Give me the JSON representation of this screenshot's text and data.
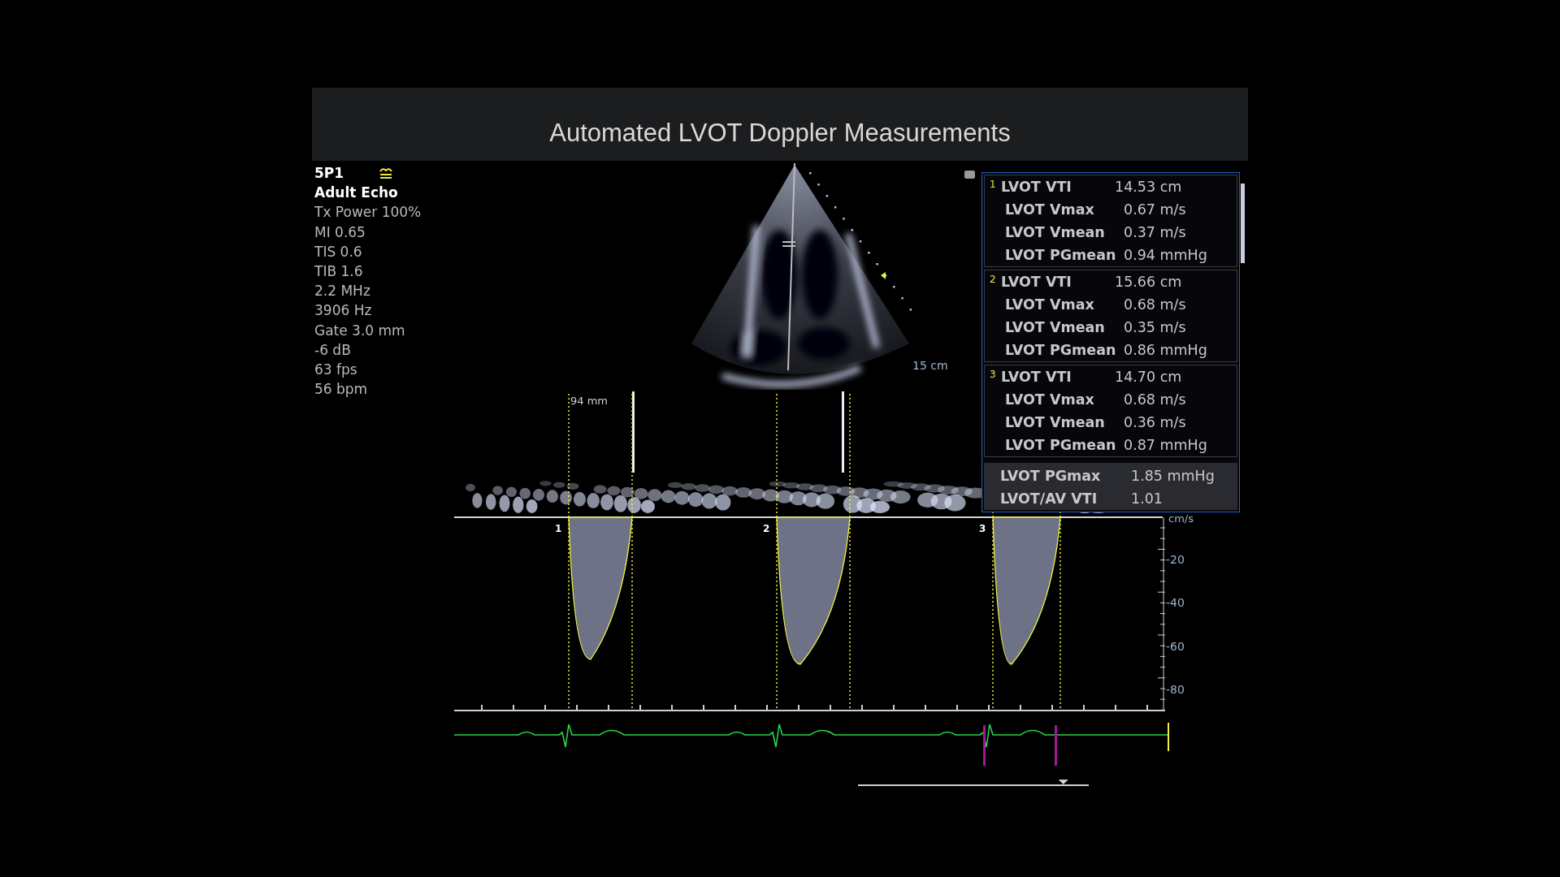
{
  "title": "Automated LVOT Doppler Measurements",
  "probe": {
    "name": "5P1",
    "preset": "Adult Echo",
    "parameters": [
      "Tx Power 100%",
      "MI 0.65",
      "TIS 0.6",
      "TIB 1.6",
      "2.2 MHz",
      "3906 Hz",
      "Gate 3.0 mm",
      "-6 dB",
      "63 fps",
      "56 bpm"
    ]
  },
  "image": {
    "depth": "15 cm"
  },
  "doppler": {
    "sweep_label": "94 mm",
    "scale_unit": "cm/s",
    "scale_labels": [
      "-20",
      "-40",
      "-60",
      "-80"
    ],
    "review_position": {
      "level": 0.89
    },
    "cycles": [
      {
        "number": "1"
      },
      {
        "number": "2"
      },
      {
        "number": "3"
      }
    ]
  },
  "measurements": {
    "groups": [
      {
        "number": "1",
        "rows": [
          {
            "label": "LVOT VTI",
            "value": "14.53 cm"
          },
          {
            "label": "LVOT Vmax",
            "value": "0.67 m/s"
          },
          {
            "label": "LVOT Vmean",
            "value": "0.37 m/s"
          },
          {
            "label": "LVOT PGmean",
            "value": "0.94 mmHg"
          }
        ]
      },
      {
        "number": "2",
        "rows": [
          {
            "label": "LVOT VTI",
            "value": "15.66 cm"
          },
          {
            "label": "LVOT Vmax",
            "value": "0.68 m/s"
          },
          {
            "label": "LVOT Vmean",
            "value": "0.35 m/s"
          },
          {
            "label": "LVOT PGmean",
            "value": "0.86 mmHg"
          }
        ]
      },
      {
        "number": "3",
        "rows": [
          {
            "label": "LVOT VTI",
            "value": "14.70 cm"
          },
          {
            "label": "LVOT Vmax",
            "value": "0.68 m/s"
          },
          {
            "label": "LVOT Vmean",
            "value": "0.36 m/s"
          },
          {
            "label": "LVOT PGmean",
            "value": "0.87 mmHg"
          }
        ]
      }
    ],
    "summary": [
      {
        "label": "LVOT PGmax",
        "value": "1.85 mmHg"
      },
      {
        "label": "LVOT/AV VTI",
        "value": "1.01"
      }
    ]
  }
}
